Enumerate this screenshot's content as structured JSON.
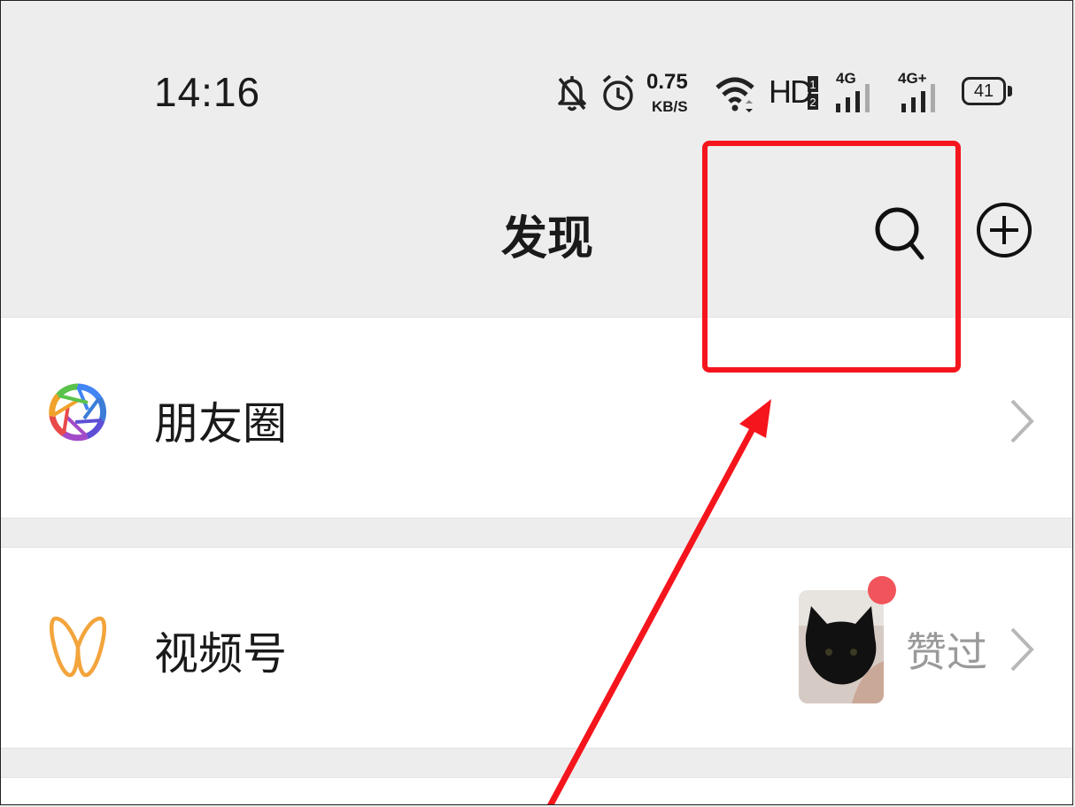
{
  "status_bar": {
    "time": "14:16",
    "net_speed_value": "0.75",
    "net_speed_unit": "KB/S",
    "hd_label": "HD",
    "sim1_label": "4G",
    "sim2_label": "4G+",
    "battery_level": "41",
    "icons": [
      "bell-off-icon",
      "alarm-icon",
      "wifi-icon",
      "hd-icon",
      "signal-icon",
      "signal-icon",
      "battery-icon"
    ]
  },
  "header": {
    "title": "发现",
    "search_icon": "search-icon",
    "add_icon": "plus-circle-icon"
  },
  "rows": [
    {
      "label": "朋友圈",
      "icon": "moments-aperture-icon"
    },
    {
      "label": "视频号",
      "icon": "channels-icon",
      "sub_text": "赞过",
      "has_red_dot": true,
      "thumbnail": "black-cat-thumbnail"
    }
  ],
  "annotation": {
    "highlight_color": "#f5151d",
    "arrow_color": "#f5151d"
  },
  "colors": {
    "background": "#ededed",
    "card": "#ffffff",
    "red_dot": "#f2545b",
    "secondary_text": "#9a9a9a"
  }
}
